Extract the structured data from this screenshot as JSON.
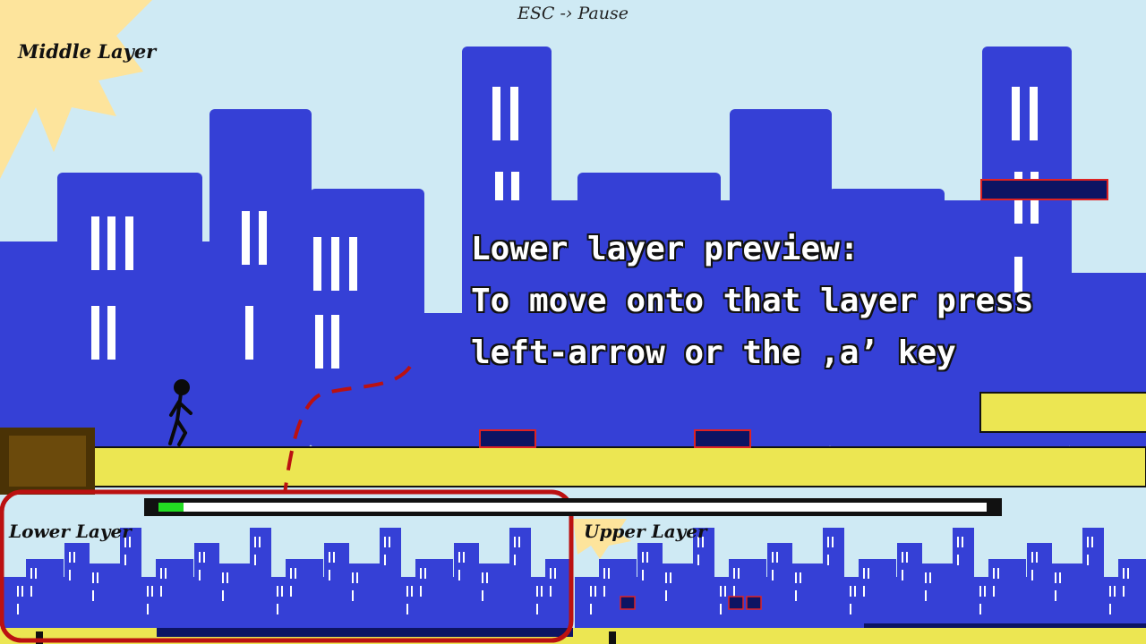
{
  "hud": {
    "pause_hint": "ESC -› Pause",
    "middle_layer_label": "Middle Layer",
    "lower_layer_label": "Lower Layer",
    "upper_layer_label": "Upper Layer"
  },
  "tutorial": {
    "lines": [
      "Lower layer preview:",
      "To move onto that layer press",
      "left-arrow or the ‚a’ key"
    ]
  },
  "level_progress": 0.03,
  "colors": {
    "sky": "#cfeaf4",
    "buildings": "#3540d6",
    "ground": "#ece652",
    "obstacle": "#0d1463",
    "obstacle_border": "#dd2222",
    "crate": "#6b4a0c",
    "sun": "#fde49c",
    "progress": "#22dd22",
    "highlight": "#bb1111"
  }
}
